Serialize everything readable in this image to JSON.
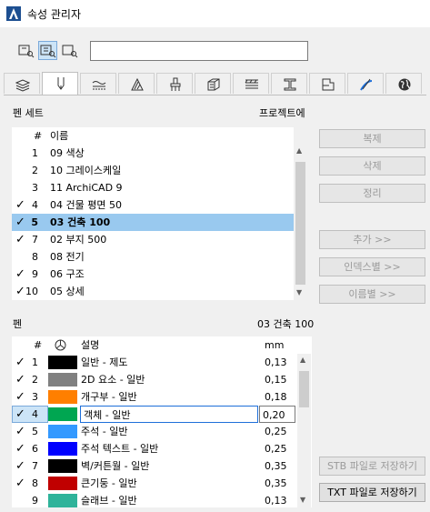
{
  "window": {
    "title": "속성 관리자"
  },
  "search": {
    "value": "",
    "placeholder": ""
  },
  "tabs": [
    {
      "icon": "layers-icon"
    },
    {
      "icon": "pen-icon",
      "active": true
    },
    {
      "icon": "linetype-icon"
    },
    {
      "icon": "fill-icon"
    },
    {
      "icon": "surface-icon"
    },
    {
      "icon": "building-material-icon"
    },
    {
      "icon": "composite-icon"
    },
    {
      "icon": "profile-icon"
    },
    {
      "icon": "zone-category-icon"
    },
    {
      "icon": "mep-icon"
    },
    {
      "icon": "globe-icon"
    }
  ],
  "penset": {
    "label": "펜 세트",
    "right_label": "프로젝트에",
    "columns": {
      "num": "#",
      "name": "이름"
    },
    "rows": [
      {
        "checked": false,
        "num": "1",
        "name": "09 색상"
      },
      {
        "checked": false,
        "num": "2",
        "name": "10 그레이스케일"
      },
      {
        "checked": false,
        "num": "3",
        "name": "11 ArchiCAD 9"
      },
      {
        "checked": true,
        "num": "4",
        "name": "04 건물 평면 50"
      },
      {
        "checked": true,
        "num": "5",
        "name": "03 건축 100",
        "selected": true
      },
      {
        "checked": true,
        "num": "7",
        "name": "02 부지 500"
      },
      {
        "checked": false,
        "num": "8",
        "name": "08 전기"
      },
      {
        "checked": true,
        "num": "9",
        "name": "06 구조"
      },
      {
        "checked": true,
        "num": "10",
        "name": "05 상세"
      }
    ]
  },
  "buttons": {
    "duplicate": "복제",
    "delete": "삭제",
    "organize": "정리",
    "add": "추가 >>",
    "by_index": "인덱스별 >>",
    "by_name": "이름별 >>",
    "save_stb": "STB 파일로 저장하기",
    "save_txt": "TXT 파일로 저장하기"
  },
  "pens": {
    "label": "펜",
    "set_name": "03 건축 100",
    "columns": {
      "num": "#",
      "desc": "설명",
      "mm": "mm"
    },
    "rows": [
      {
        "checked": true,
        "num": "1",
        "color": "#000000",
        "desc": "일반 - 제도",
        "mm": "0,13"
      },
      {
        "checked": true,
        "num": "2",
        "color": "#808080",
        "desc": "2D 요소 - 일반",
        "mm": "0,15"
      },
      {
        "checked": true,
        "num": "3",
        "color": "#ff7f00",
        "desc": "개구부 - 일반",
        "mm": "0,18"
      },
      {
        "checked": true,
        "num": "4",
        "color": "#00a651",
        "desc": "객체 - 일반",
        "mm": "0,20",
        "editing": true
      },
      {
        "checked": true,
        "num": "5",
        "color": "#3399ff",
        "desc": "주석 - 일반",
        "mm": "0,25"
      },
      {
        "checked": true,
        "num": "6",
        "color": "#0000ff",
        "desc": "주석 텍스트 - 일반",
        "mm": "0,25"
      },
      {
        "checked": true,
        "num": "7",
        "color": "#000000",
        "desc": "벽/커튼월 - 일반",
        "mm": "0,35"
      },
      {
        "checked": true,
        "num": "8",
        "color": "#c00000",
        "desc": "큰기둥 - 일반",
        "mm": "0,35"
      },
      {
        "checked": false,
        "num": "9",
        "color": "#2fb39a",
        "desc": "슬래브 - 일반",
        "mm": "0,13"
      }
    ]
  }
}
